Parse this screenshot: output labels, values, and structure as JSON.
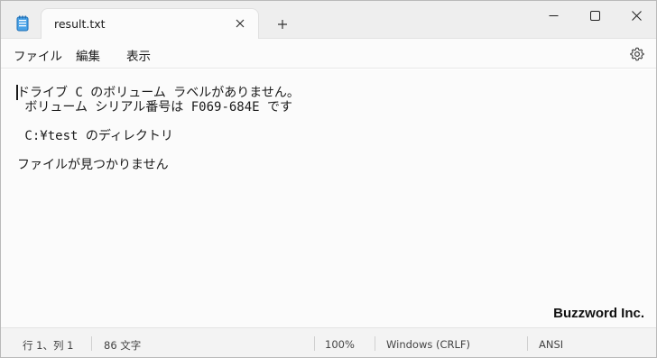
{
  "tab": {
    "title": "result.txt"
  },
  "menu": {
    "file": "ファイル",
    "edit": "編集",
    "view": "表示"
  },
  "editor": {
    "lines": [
      "ドライブ C のボリューム ラベルがありません。",
      " ボリューム シリアル番号は F069-684E です",
      "",
      " C:¥test のディレクトリ",
      "",
      "ファイルが見つかりません"
    ]
  },
  "watermark": "Buzzword Inc.",
  "status": {
    "position": "行 1、列 1",
    "char_count": "86 文字",
    "zoom": "100%",
    "line_ending": "Windows (CRLF)",
    "encoding": "ANSI"
  },
  "icons": {
    "app": "notepad-icon",
    "close_tab": "close-icon",
    "new_tab": "plus-icon",
    "minimize": "minimize-icon",
    "maximize": "maximize-icon",
    "close_window": "close-icon",
    "settings": "gear-icon"
  },
  "colors": {
    "accent": "#2b7fd6"
  }
}
